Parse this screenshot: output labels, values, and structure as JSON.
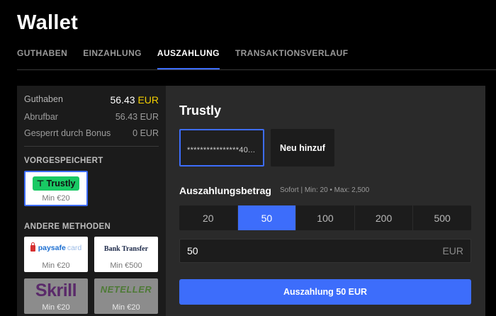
{
  "page": {
    "title": "Wallet"
  },
  "tabs": [
    {
      "label": "GUTHABEN"
    },
    {
      "label": "EINZAHLUNG"
    },
    {
      "label": "AUSZAHLUNG",
      "active": true
    },
    {
      "label": "TRANSAKTIONSVERLAUF"
    }
  ],
  "balance": {
    "total_label": "Guthaben",
    "total_value": "56.43",
    "currency": "EUR",
    "available_label": "Abrufbar",
    "available_value": "56.43 EUR",
    "locked_label": "Gesperrt durch Bonus",
    "locked_value": "0 EUR"
  },
  "saved": {
    "heading": "VORGESPEICHERT",
    "methods": [
      {
        "name": "Trustly",
        "min": "Min €20"
      }
    ]
  },
  "other": {
    "heading": "ANDERE METHODEN",
    "methods": [
      {
        "name": "paysafe",
        "name_suffix": "card",
        "min": "Min €20"
      },
      {
        "name": "Bank Transfer",
        "min": "Min €500"
      },
      {
        "name": "Skrill",
        "min": "Min €20"
      },
      {
        "name": "NETELLER",
        "min": "Min €20"
      }
    ]
  },
  "withdraw": {
    "method_title": "Trustly",
    "account_masked": "****************40...",
    "add_new": "Neu hinzuf",
    "amount_label": "Auszahlungsbetrag",
    "amount_hint": "Sofort | Min: 20 • Max: 2,500",
    "presets": [
      "20",
      "50",
      "100",
      "200",
      "500"
    ],
    "selected_preset": "50",
    "amount_value": "50",
    "amount_unit": "EUR",
    "submit_label": "Auszahlung 50 EUR"
  },
  "colors": {
    "accent": "#3d6dfb",
    "currency_highlight": "#f4d000",
    "trustly_green": "#19c964"
  }
}
